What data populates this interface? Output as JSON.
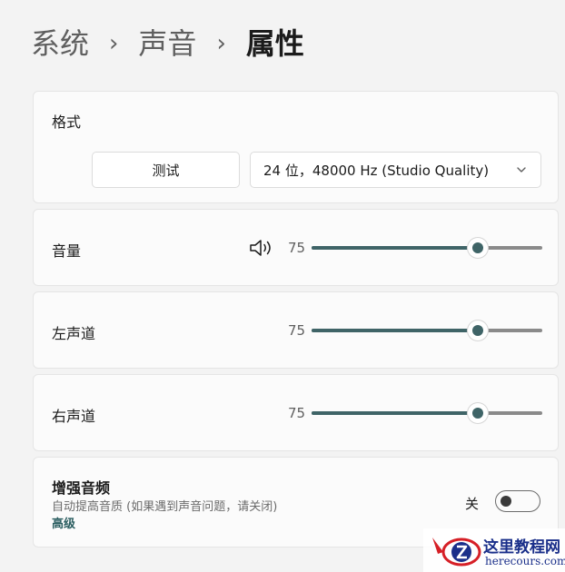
{
  "breadcrumb": {
    "items": [
      "系统",
      "声音",
      "属性"
    ],
    "separator": "›"
  },
  "format": {
    "label": "格式",
    "test_button": "测试",
    "select_value": "24 位，48000 Hz (Studio Quality)"
  },
  "volume": {
    "label": "音量",
    "value": "75",
    "level": 75,
    "icon": "speaker-icon"
  },
  "left_channel": {
    "label": "左声道",
    "value": "75",
    "level": 75
  },
  "right_channel": {
    "label": "右声道",
    "value": "75",
    "level": 75
  },
  "enhance": {
    "title": "增强音频",
    "description": "自动提高音质 (如果遇到声音问题，请关闭)",
    "advanced_link": "高级",
    "toggle_label": "关",
    "toggle_on": false
  },
  "watermark": {
    "name": "这里教程网",
    "url": "herecours.com"
  },
  "colors": {
    "accent": "#3f6467",
    "background": "#f3f3f3",
    "card": "#fbfbfb"
  }
}
